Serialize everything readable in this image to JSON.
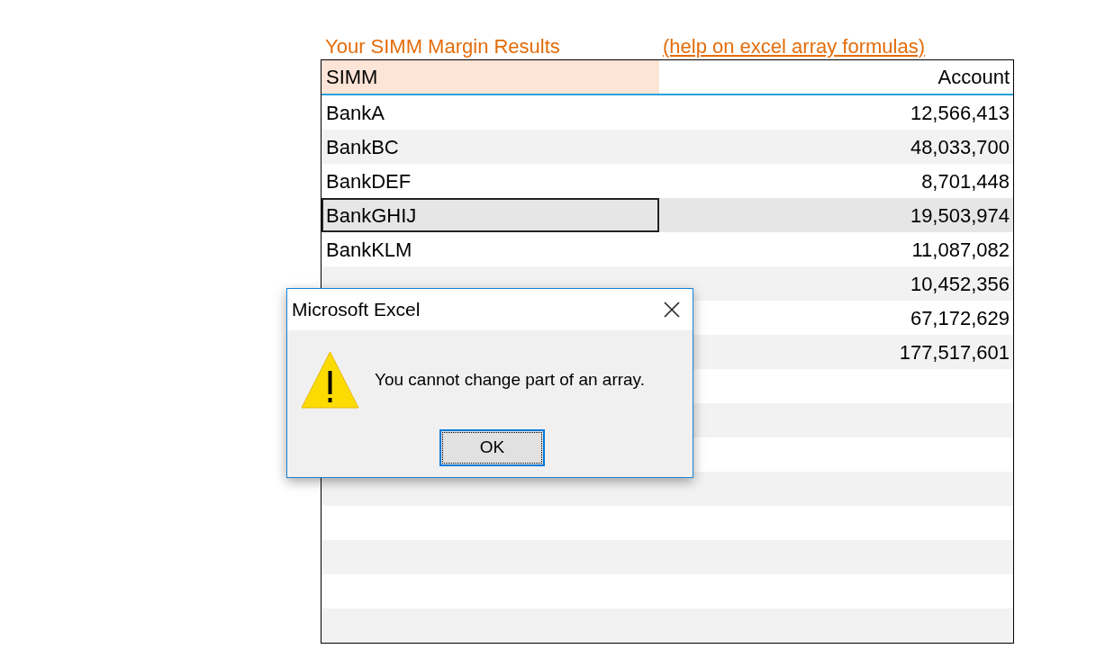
{
  "title": "Your SIMM Margin Results",
  "help_link": "(help on excel array formulas)",
  "table": {
    "columns": [
      "SIMM",
      "Account"
    ],
    "rows": [
      {
        "name": "BankA",
        "value": "12,566,413",
        "selected": false
      },
      {
        "name": "BankBC",
        "value": "48,033,700",
        "selected": false
      },
      {
        "name": "BankDEF",
        "value": "8,701,448",
        "selected": false
      },
      {
        "name": "BankGHIJ",
        "value": "19,503,974",
        "selected": true
      },
      {
        "name": "BankKLM",
        "value": "11,087,082",
        "selected": false
      },
      {
        "value": "10,452,356",
        "selected": false
      },
      {
        "value": "67,172,629",
        "selected": false
      },
      {
        "value": "177,517,601",
        "selected": false
      }
    ]
  },
  "dialog": {
    "title": "Microsoft Excel",
    "message": "You cannot change part of an array.",
    "buttons": [
      "OK"
    ]
  }
}
